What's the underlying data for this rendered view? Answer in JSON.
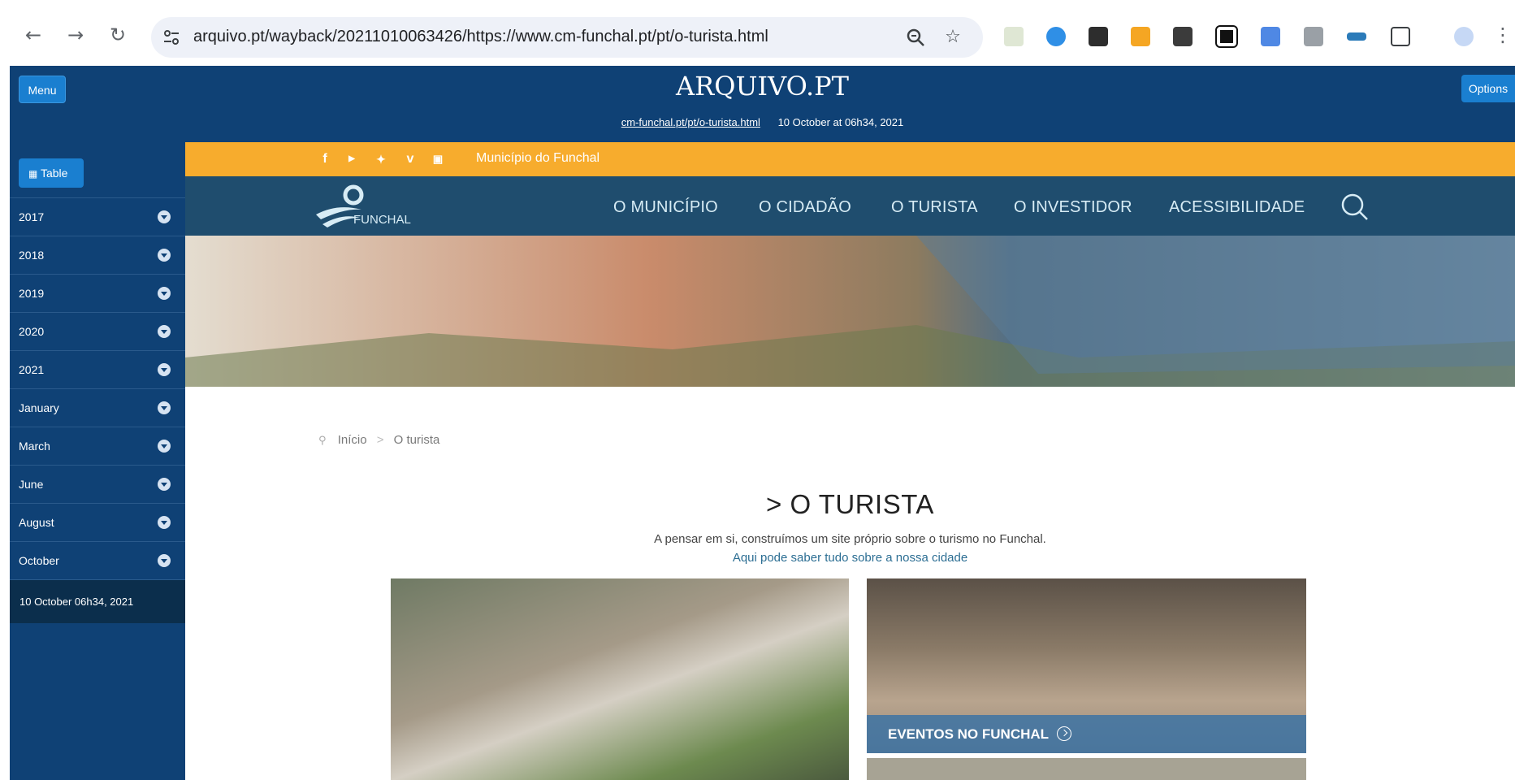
{
  "browser": {
    "url": "arquivo.pt/wayback/20211010063426/https://www.cm-funchal.pt/pt/o-turista.html"
  },
  "arquivo": {
    "logo": "ARQUIVO.PT",
    "menu_label": "Menu",
    "options_label": "Options",
    "archived_link": "cm-funchal.pt/pt/o-turista.html",
    "archived_date": "10 October at 06h34, 2021"
  },
  "sidebar": {
    "table_label": "Table",
    "items": [
      {
        "label": "2017"
      },
      {
        "label": "2018"
      },
      {
        "label": "2019"
      },
      {
        "label": "2020"
      },
      {
        "label": "2021"
      },
      {
        "label": "January"
      },
      {
        "label": "March"
      },
      {
        "label": "June"
      },
      {
        "label": "August"
      },
      {
        "label": "October"
      }
    ],
    "selected": "10 October 06h34, 2021"
  },
  "site": {
    "topbar_label": "Município do Funchal",
    "logo_text": "FUNCHAL",
    "nav": [
      {
        "label": "O MUNICÍPIO"
      },
      {
        "label": "O CIDADÃO"
      },
      {
        "label": "O TURISTA"
      },
      {
        "label": "O INVESTIDOR"
      },
      {
        "label": "ACESSIBILIDADE"
      }
    ],
    "breadcrumb_home": "Início",
    "breadcrumb_sep": ">",
    "breadcrumb_current": "O turista",
    "title": "> O TURISTA",
    "description": "A pensar em si, construímos um site próprio sobre o turismo no Funchal.",
    "subtitle": "Aqui pode saber tudo sobre a nossa cidade",
    "tile_events": "EVENTOS NO FUNCHAL"
  },
  "colors": {
    "arquivo_blue": "#0f4175",
    "button_blue": "#1a7fd0",
    "site_nav": "#1f4d6e",
    "site_yellow": "#f7ac2d"
  }
}
